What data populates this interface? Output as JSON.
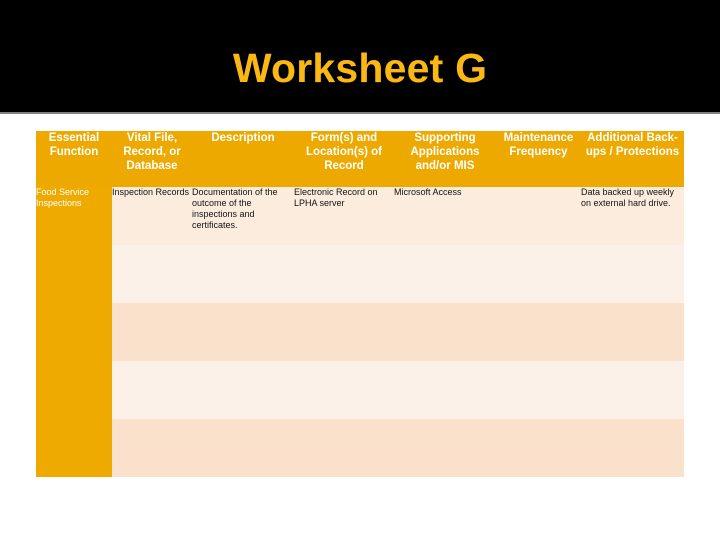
{
  "slide": {
    "title": "Worksheet G",
    "title_color": "#FBB813",
    "band_color": "#000000"
  },
  "table": {
    "accent_color": "#EDA900",
    "first_column_color": "#EFAA00",
    "row_band_light": "#FBF1E9",
    "row_band_dark": "#FAE1CB",
    "headers": [
      "Essential Function",
      "Vital File, Record, or Database",
      "Description",
      "Form(s) and Location(s) of Record",
      "Supporting Applications and/or MIS",
      "Maintenance Frequency",
      "Additional Back-ups / Protections"
    ],
    "rows": [
      {
        "essential_function": "Food Service Inspections",
        "vital_file": "Inspection Records",
        "description": "Documentation of the outcome of the inspections and certificates.",
        "form_location": "Electronic Record on LPHA server",
        "supporting_applications": "Microsoft Access",
        "maintenance_frequency": "",
        "additional_backups": "Data backed up weekly on external hard drive."
      },
      {
        "essential_function": "",
        "vital_file": "",
        "description": "",
        "form_location": "",
        "supporting_applications": "",
        "maintenance_frequency": "",
        "additional_backups": ""
      },
      {
        "essential_function": "",
        "vital_file": "",
        "description": "",
        "form_location": "",
        "supporting_applications": "",
        "maintenance_frequency": "",
        "additional_backups": ""
      },
      {
        "essential_function": "",
        "vital_file": "",
        "description": "",
        "form_location": "",
        "supporting_applications": "",
        "maintenance_frequency": "",
        "additional_backups": ""
      },
      {
        "essential_function": "",
        "vital_file": "",
        "description": "",
        "form_location": "",
        "supporting_applications": "",
        "maintenance_frequency": "",
        "additional_backups": ""
      }
    ]
  }
}
